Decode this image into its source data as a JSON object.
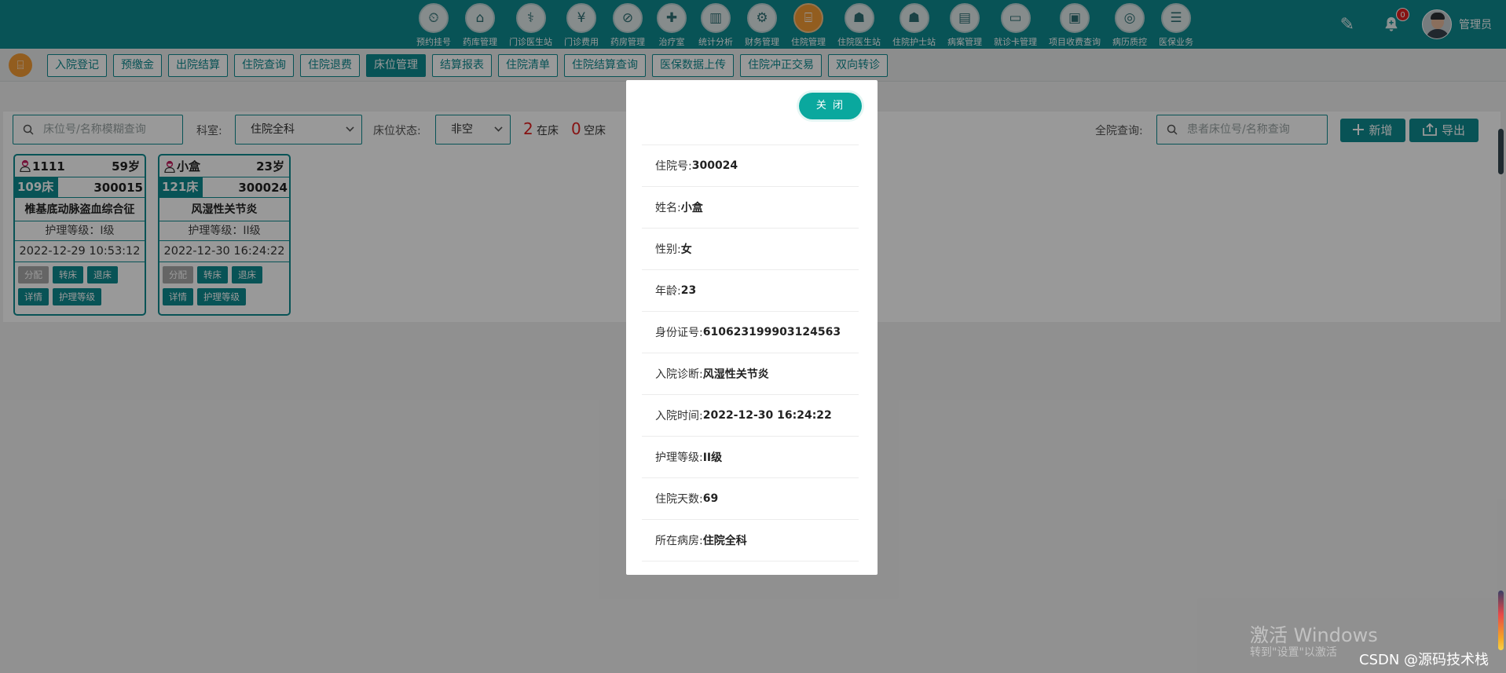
{
  "top_nav": {
    "items": [
      {
        "label": "预约挂号",
        "icon": "calendar-clock-icon",
        "glyph": "⏲",
        "active": false
      },
      {
        "label": "药库管理",
        "icon": "warehouse-icon",
        "glyph": "⌂",
        "active": false
      },
      {
        "label": "门诊医生站",
        "icon": "doctor-icon",
        "glyph": "⚕",
        "active": false
      },
      {
        "label": "门诊费用",
        "icon": "yen-icon",
        "glyph": "¥",
        "active": false
      },
      {
        "label": "药房管理",
        "icon": "pill-icon",
        "glyph": "⊘",
        "active": false
      },
      {
        "label": "治疗室",
        "icon": "nurse-icon",
        "glyph": "✚",
        "active": false
      },
      {
        "label": "统计分析",
        "icon": "bar-chart-icon",
        "glyph": "▥",
        "active": false
      },
      {
        "label": "财务管理",
        "icon": "gear-icon",
        "glyph": "⚙",
        "active": false
      },
      {
        "label": "住院管理",
        "icon": "hospital-bed-icon",
        "glyph": "⌸",
        "active": true
      },
      {
        "label": "住院医生站",
        "icon": "doctor-card-icon",
        "glyph": "☗",
        "active": false
      },
      {
        "label": "住院护士站",
        "icon": "nurse-card-icon",
        "glyph": "☗",
        "active": false
      },
      {
        "label": "病案管理",
        "icon": "medical-record-icon",
        "glyph": "▤",
        "active": false
      },
      {
        "label": "就诊卡管理",
        "icon": "id-card-icon",
        "glyph": "▭",
        "active": false
      },
      {
        "label": "项目收费查询",
        "icon": "receipt-icon",
        "glyph": "▣",
        "active": false
      },
      {
        "label": "病历质控",
        "icon": "washer-icon",
        "glyph": "◎",
        "active": false
      },
      {
        "label": "医保业务",
        "icon": "insurance-card-icon",
        "glyph": "☰",
        "active": false
      }
    ],
    "notification_count": "0",
    "username": "管理员"
  },
  "sub_tabs": [
    {
      "label": "入院登记",
      "active": false
    },
    {
      "label": "预缴金",
      "active": false
    },
    {
      "label": "出院结算",
      "active": false
    },
    {
      "label": "住院查询",
      "active": false
    },
    {
      "label": "住院退费",
      "active": false
    },
    {
      "label": "床位管理",
      "active": true
    },
    {
      "label": "结算报表",
      "active": false
    },
    {
      "label": "住院清单",
      "active": false
    },
    {
      "label": "住院结算查询",
      "active": false
    },
    {
      "label": "医保数据上传",
      "active": false
    },
    {
      "label": "住院冲正交易",
      "active": false
    },
    {
      "label": "双向转诊",
      "active": false
    }
  ],
  "filters": {
    "bed_search_placeholder": "床位号/名称模糊查询",
    "dept_label": "科室:",
    "dept_value": "住院全科",
    "status_label": "床位状态:",
    "status_value": "非空",
    "occupied_count": "2",
    "occupied_label": "在床",
    "empty_count": "0",
    "empty_label": "空床",
    "global_search_label": "全院查询:",
    "global_search_placeholder": "患者床位号/名称查询",
    "add_label": "新增",
    "export_label": "导出"
  },
  "beds": [
    {
      "name": "1111",
      "age": "59岁",
      "bed": "109床",
      "inpatient_no": "300015",
      "diagnosis": "椎基底动脉盗血综合征",
      "nursing_level": "护理等级：I级",
      "time": "2022-12-29 10:53:12",
      "actions": [
        "分配",
        "转床",
        "退床",
        "详情",
        "护理等级"
      ]
    },
    {
      "name": "小盒",
      "age": "23岁",
      "bed": "121床",
      "inpatient_no": "300024",
      "diagnosis": "风湿性关节炎",
      "nursing_level": "护理等级：II级",
      "time": "2022-12-30 16:24:22",
      "actions": [
        "分配",
        "转床",
        "退床",
        "详情",
        "护理等级"
      ]
    }
  ],
  "modal": {
    "close_label": "关 闭",
    "fields": [
      {
        "label": "住院号:",
        "value": "300024"
      },
      {
        "label": "姓名:",
        "value": "小盒"
      },
      {
        "label": "性别:",
        "value": "女"
      },
      {
        "label": "年龄:",
        "value": "23"
      },
      {
        "label": "身份证号:",
        "value": "610623199903124563"
      },
      {
        "label": "入院诊断:",
        "value": "风湿性关节炎"
      },
      {
        "label": "入院时间:",
        "value": "2022-12-30 16:24:22"
      },
      {
        "label": "护理等级:",
        "value": "II级"
      },
      {
        "label": "住院天数:",
        "value": "69"
      },
      {
        "label": "所在病房:",
        "value": "住院全科"
      }
    ]
  },
  "watermarks": {
    "windows_line1": "激活 Windows",
    "windows_line2": "转到\"设置\"以激活",
    "csdn": "CSDN @源码技术栈"
  },
  "colors": {
    "primary": "#0e8a8f",
    "accent_orange": "#f39b34",
    "close_button": "#0aa89e",
    "count_red": "#e02020"
  }
}
